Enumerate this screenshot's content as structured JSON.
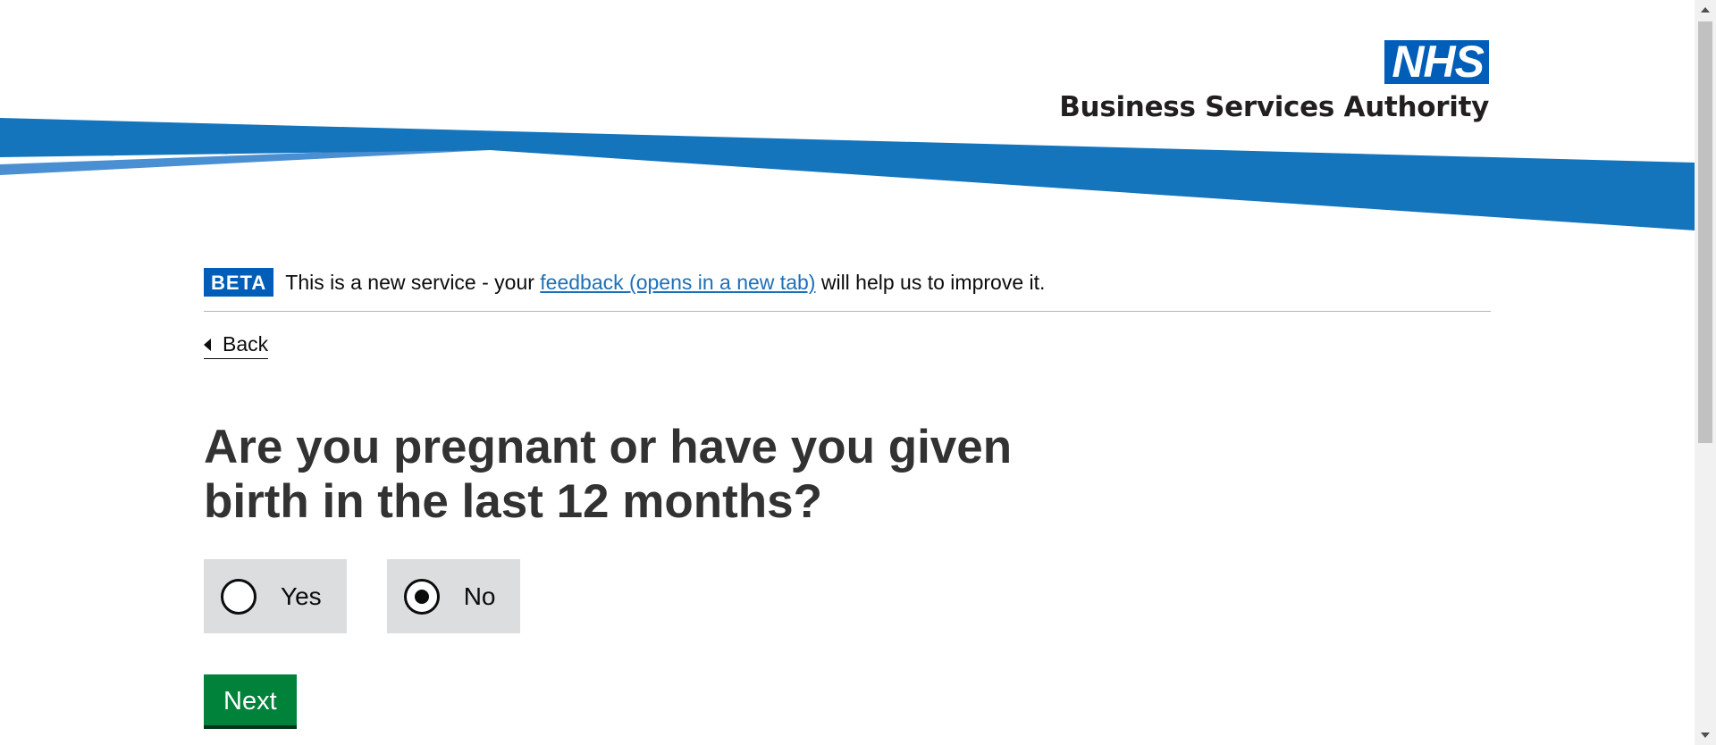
{
  "header": {
    "logo_text": "NHS",
    "org_name": "Business Services Authority",
    "colors": {
      "band_light": "#4a8fd1",
      "band_dark": "#0f6db5",
      "logo_blue": "#005eb8"
    }
  },
  "phase_banner": {
    "tag": "BETA",
    "text_before": "This is a new service - your",
    "link_text": "feedback (opens in a new tab)",
    "text_after": "will help us to improve it."
  },
  "back_link": {
    "label": "Back",
    "icon": "chevron-left-icon"
  },
  "question": {
    "title": "Are you pregnant or have you given birth in the last 12 months?",
    "options": [
      {
        "label": "Yes",
        "selected": false
      },
      {
        "label": "No",
        "selected": true
      }
    ]
  },
  "actions": {
    "next_label": "Next",
    "button_color": "#00823b"
  }
}
